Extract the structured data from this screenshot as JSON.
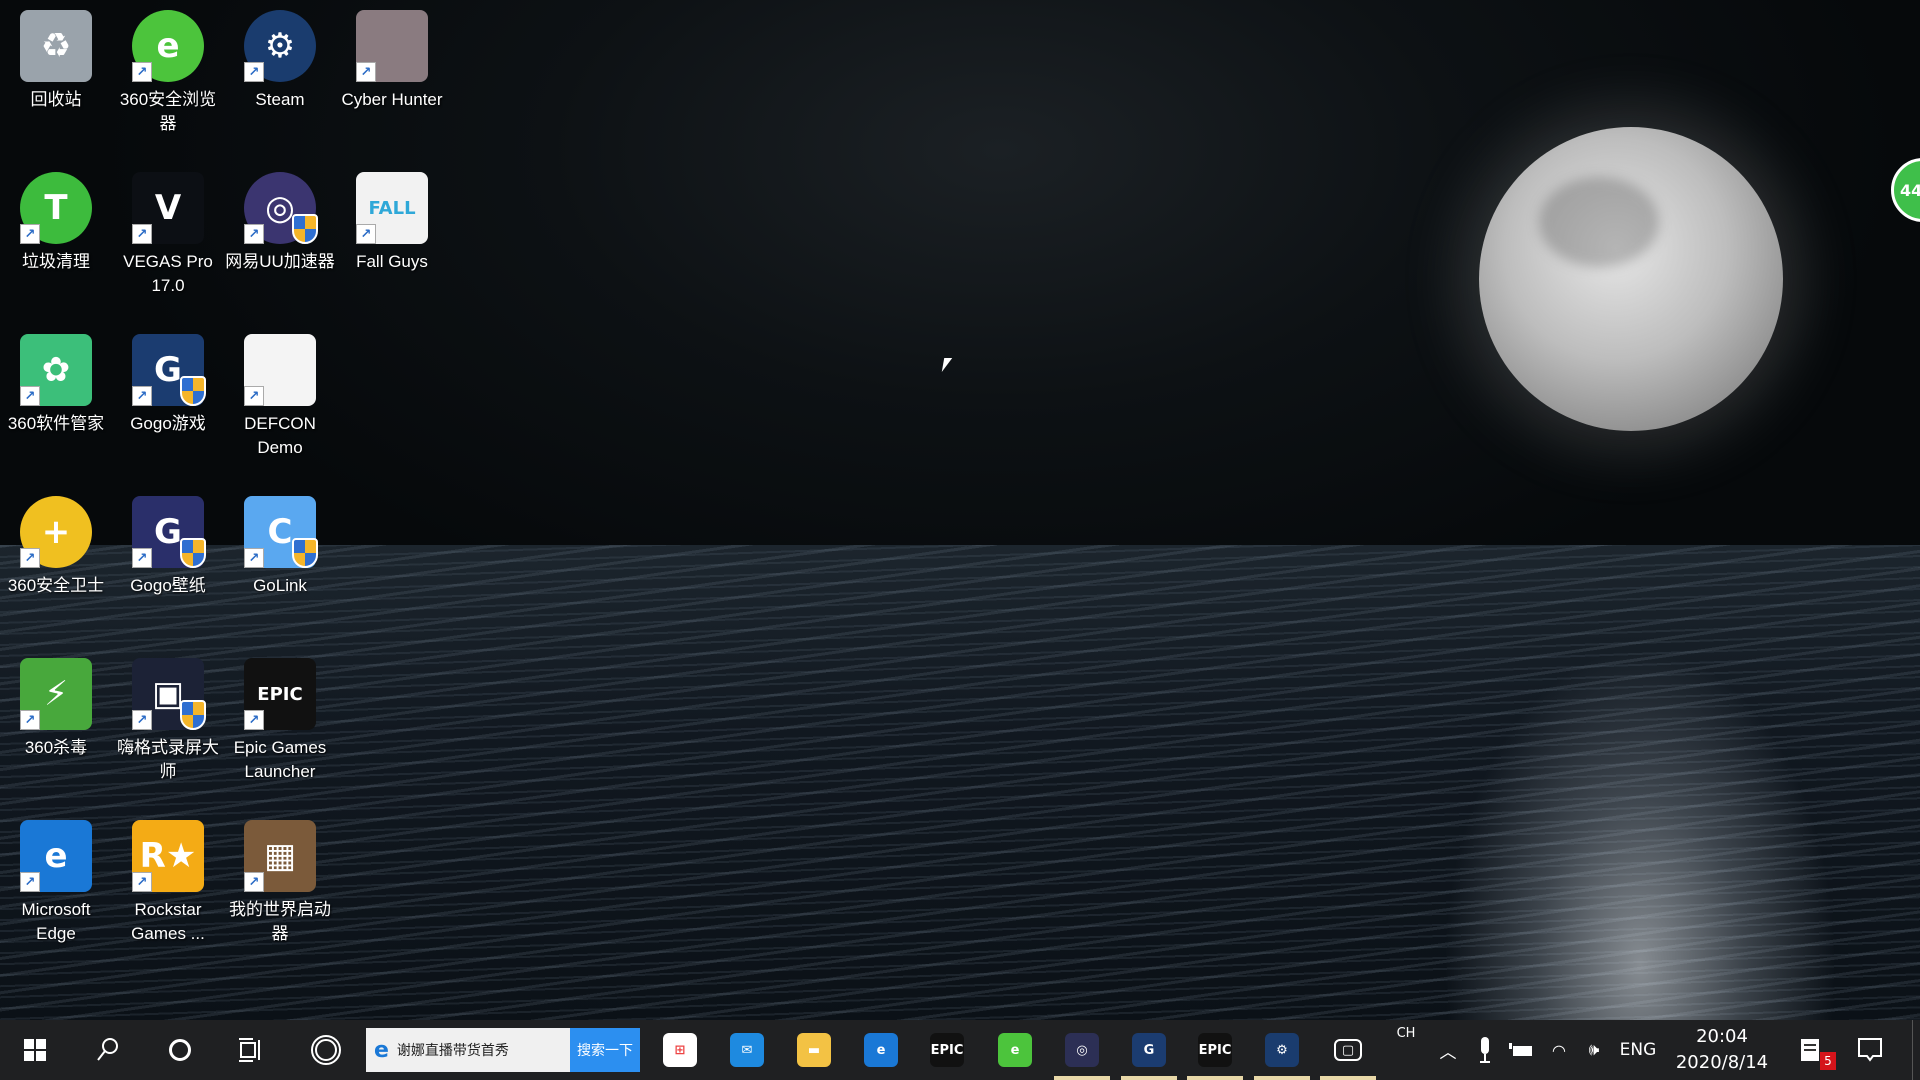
{
  "desktop_icons": [
    {
      "label": "回收站",
      "icon": "recycle-bin-icon",
      "color": "#9aa3ab",
      "glyph": "♻"
    },
    {
      "label": "360安全浏览器",
      "icon": "360-browser-icon",
      "color": "#4cc43c",
      "glyph": "e"
    },
    {
      "label": "Steam",
      "icon": "steam-icon",
      "color": "#1a3c6e",
      "glyph": "⚙"
    },
    {
      "label": "Cyber Hunter",
      "icon": "cyber-hunter-icon",
      "color": "#8a7b80",
      "glyph": ""
    },
    {
      "label": "垃圾清理",
      "icon": "trash-cleaner-icon",
      "color": "#3dbb3d",
      "glyph": "T"
    },
    {
      "label": "VEGAS Pro 17.0",
      "icon": "vegas-pro-icon",
      "color": "#0c0f14",
      "glyph": "V"
    },
    {
      "label": "网易UU加速器",
      "icon": "uu-accelerator-icon",
      "color": "#3b3570",
      "glyph": "◎"
    },
    {
      "label": "Fall Guys",
      "icon": "fall-guys-icon",
      "color": "#f2f2f2",
      "glyph": "FALL"
    },
    {
      "label": "360软件管家",
      "icon": "360-software-manager-icon",
      "color": "#3cbf7a",
      "glyph": "✿"
    },
    {
      "label": "Gogo游戏",
      "icon": "gogo-game-icon",
      "color": "#1b3c70",
      "glyph": "G"
    },
    {
      "label": "DEFCON Demo",
      "icon": "file-icon",
      "color": "#f4f4f4",
      "glyph": ""
    },
    {
      "label": "360安全卫士",
      "icon": "360-security-icon",
      "color": "#f0c020",
      "glyph": "+"
    },
    {
      "label": "Gogo壁纸",
      "icon": "gogo-wallpaper-icon",
      "color": "#2a2f6a",
      "glyph": "G"
    },
    {
      "label": "GoLink",
      "icon": "golink-icon",
      "color": "#5aa8f0",
      "glyph": "C"
    },
    {
      "label": "360杀毒",
      "icon": "360-antivirus-icon",
      "color": "#48a83c",
      "glyph": "⚡"
    },
    {
      "label": "嗨格式录屏大师",
      "icon": "screen-recorder-icon",
      "color": "#1c2236",
      "glyph": "▣"
    },
    {
      "label": "Epic Games Launcher",
      "icon": "epic-games-icon",
      "color": "#111",
      "glyph": "EPIC"
    },
    {
      "label": "Microsoft Edge",
      "icon": "edge-icon",
      "color": "#1a78d6",
      "glyph": "e"
    },
    {
      "label": "Rockstar Games ...",
      "icon": "rockstar-icon",
      "color": "#f4ab15",
      "glyph": "R★"
    },
    {
      "label": "我的世界启动器",
      "icon": "minecraft-launcher-icon",
      "color": "#7b5a3a",
      "glyph": "▦"
    }
  ],
  "notification_bubble": "44",
  "taskbar": {
    "search_box_text": "谢娜直播带货首秀",
    "search_button": "搜索一下",
    "apps": [
      {
        "name": "microsoft-store",
        "glyph": "⊞",
        "color": "#fff",
        "active": false
      },
      {
        "name": "mail",
        "glyph": "✉",
        "color": "#1e8ae0",
        "active": false
      },
      {
        "name": "file-explorer",
        "glyph": "▬",
        "color": "#f3c244",
        "active": false
      },
      {
        "name": "edge",
        "glyph": "e",
        "color": "#1a78d6",
        "active": false
      },
      {
        "name": "epic-games",
        "glyph": "EPIC",
        "color": "#111",
        "active": false
      },
      {
        "name": "360-browser",
        "glyph": "e",
        "color": "#4cc43c",
        "active": false
      },
      {
        "name": "uu-accelerator",
        "glyph": "◎",
        "color": "#2c2f55",
        "active": true
      },
      {
        "name": "gogo",
        "glyph": "G",
        "color": "#1b3c70",
        "active": true
      },
      {
        "name": "epic-games-2",
        "glyph": "EPIC",
        "color": "#111",
        "active": true
      },
      {
        "name": "steam",
        "glyph": "⚙",
        "color": "#1a3c6e",
        "active": true
      },
      {
        "name": "screen-recorder",
        "glyph": "▢",
        "color": "#1f2022",
        "active": true
      }
    ],
    "ime": "CH",
    "language": "ENG",
    "time": "20:04",
    "date": "2020/8/14",
    "notification_count": "5"
  }
}
